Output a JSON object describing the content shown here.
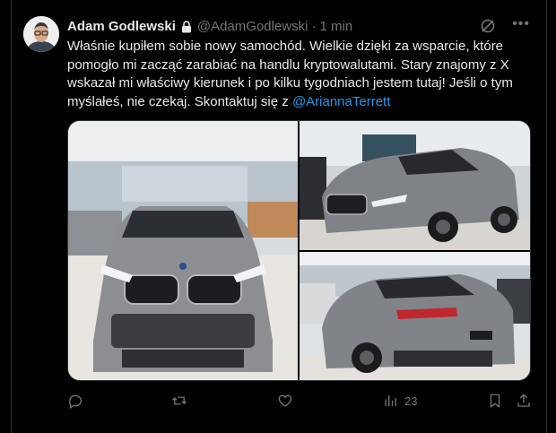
{
  "tweet": {
    "author_name": "Adam Godlewski",
    "handle": "@AdamGodlewski",
    "separator": "·",
    "time": "1 min",
    "text_main": "Właśnie kupiłem sobie nowy samochód. Wielkie dzięki za wsparcie, które pomogło mi zacząć zarabiać na handlu kryptowalutami. Stary znajomy z X wskazał mi właściwy kierunek i po kilku tygodniach jestem tutaj! Jeśli o tym myślałeś, nie czekaj. Skontaktuj się z ",
    "mention": "@AriannaTerrett",
    "views_count": "23"
  },
  "icons": {
    "lock": "lock-icon",
    "grok": "grok-icon",
    "more": "more-icon",
    "reply": "reply-icon",
    "repost": "repost-icon",
    "like": "like-icon",
    "views": "views-icon",
    "bookmark": "bookmark-icon",
    "share": "share-icon"
  },
  "colors": {
    "background": "#000000",
    "text": "#e7e9ea",
    "muted": "#71767b",
    "link": "#1d9bf0",
    "border": "#2f3336"
  }
}
